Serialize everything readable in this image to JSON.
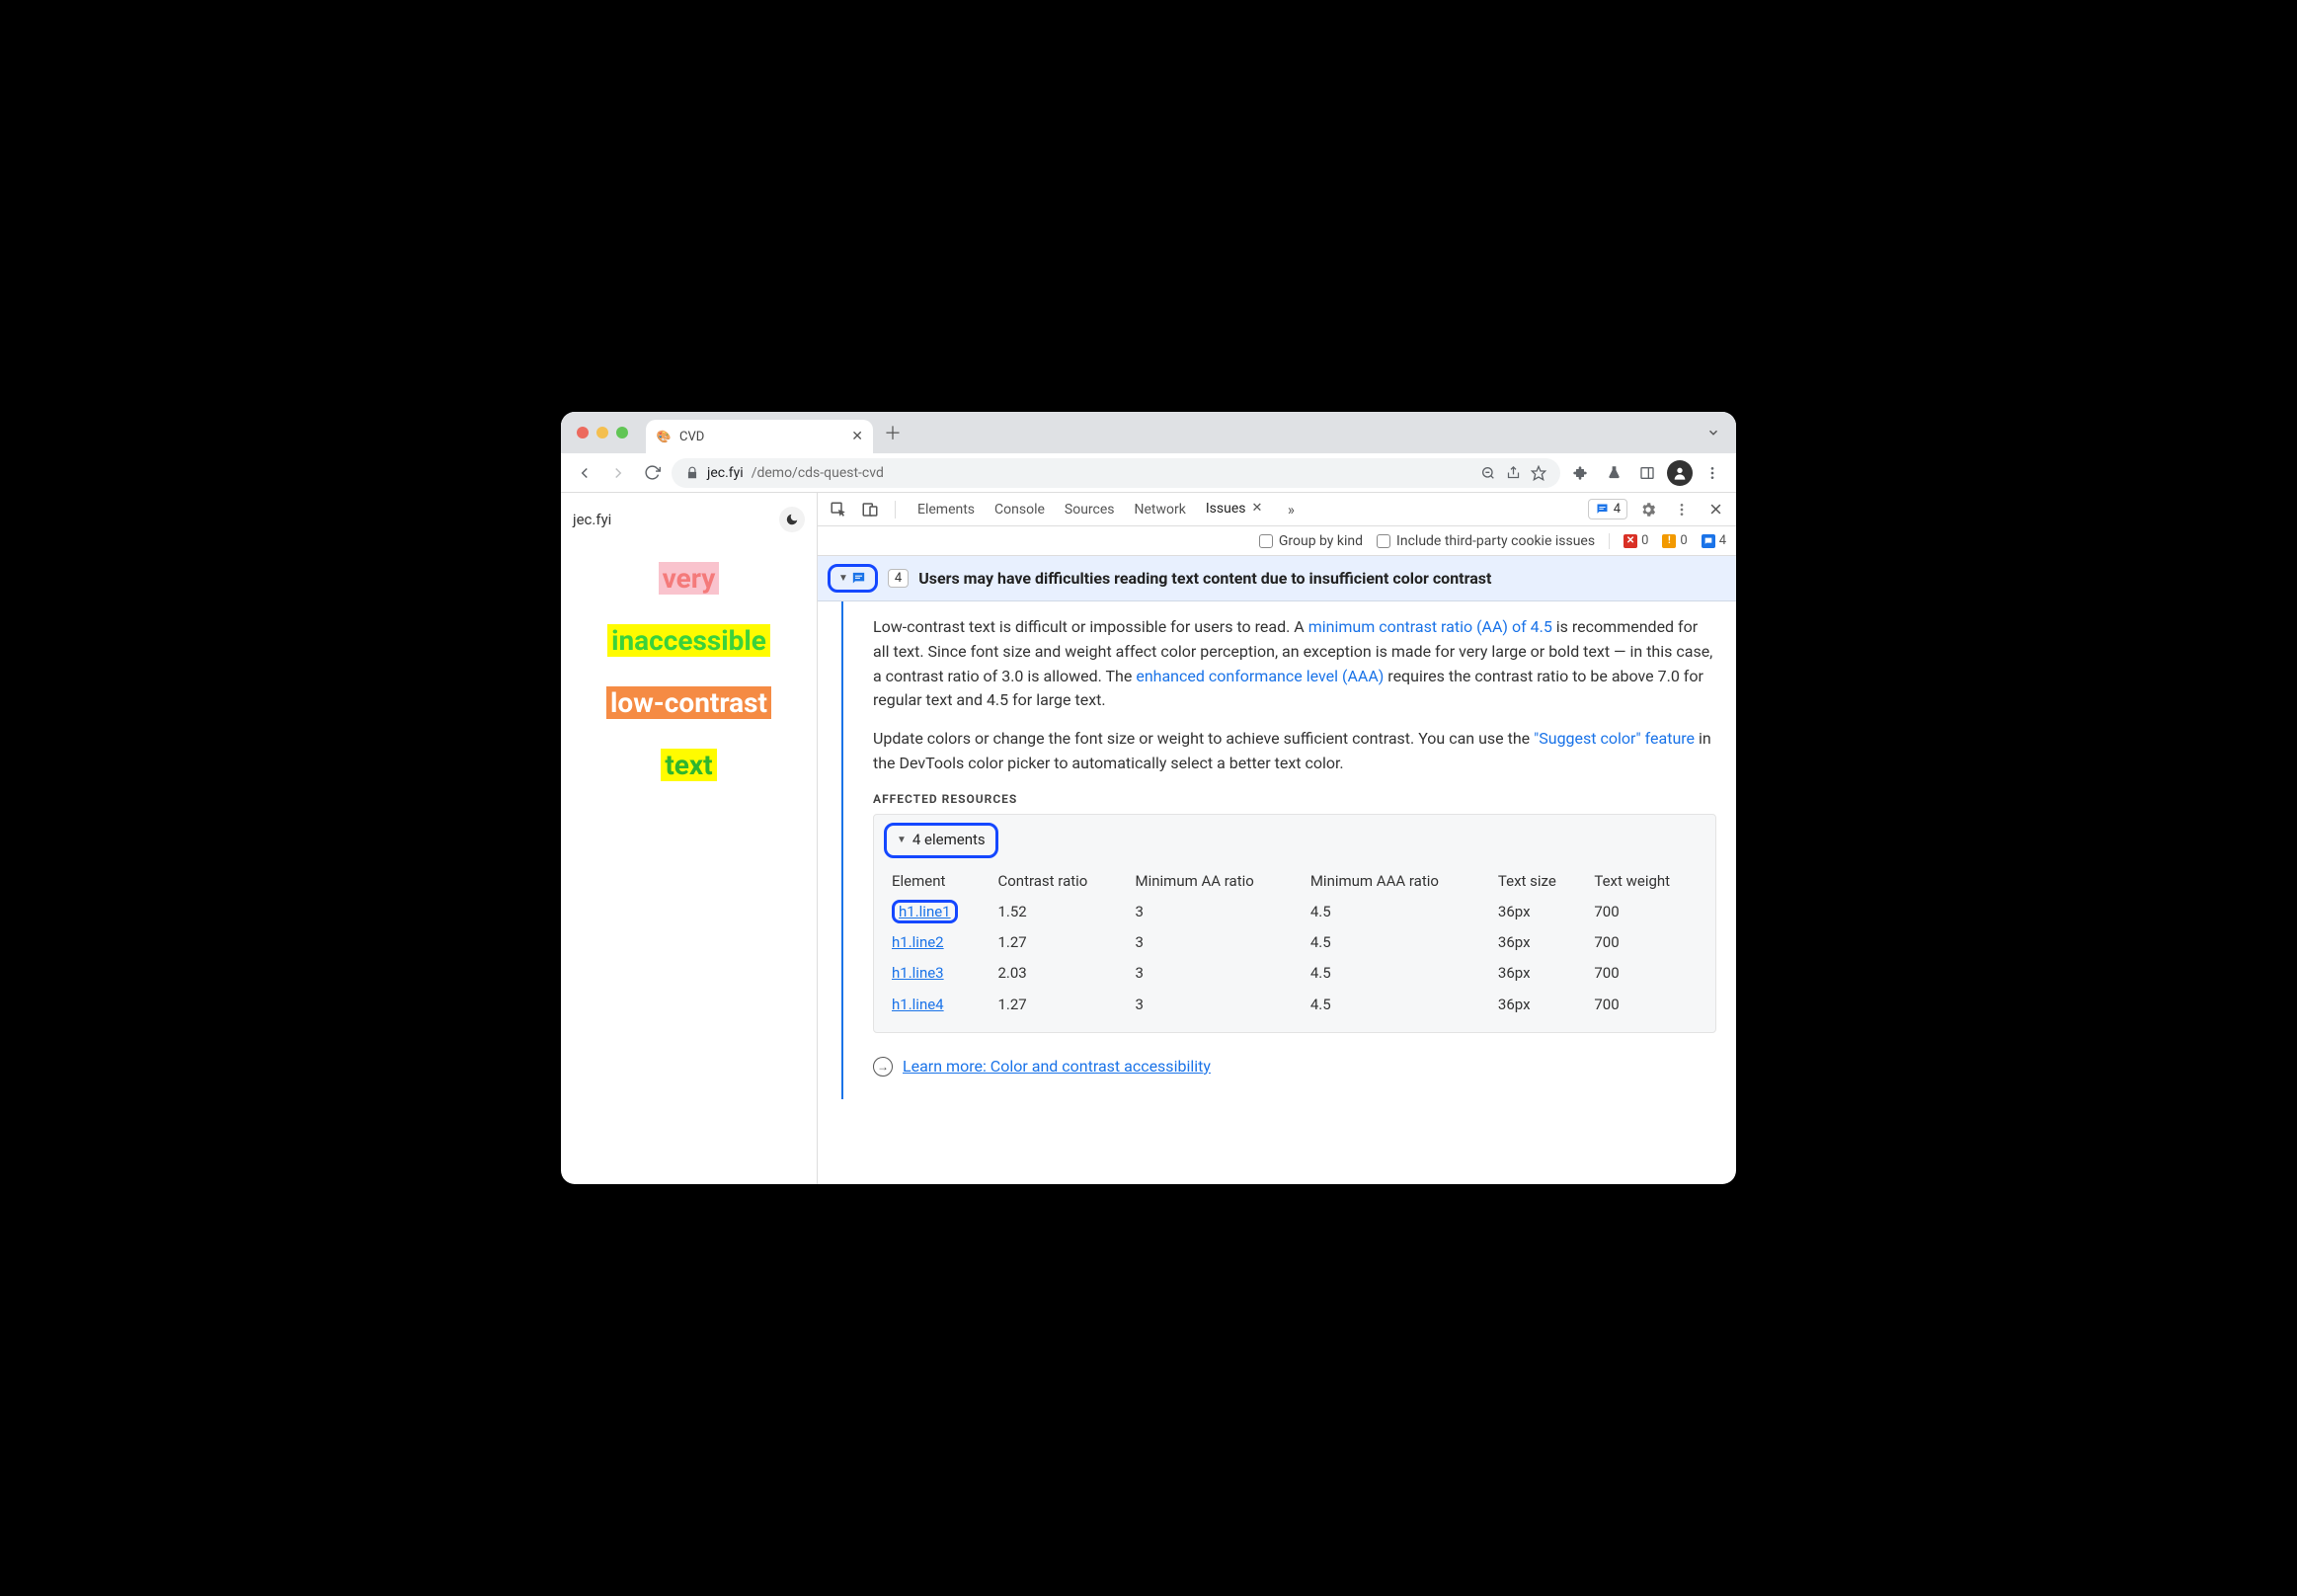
{
  "browser": {
    "tab_title": "CVD",
    "url_domain": "jec.fyi",
    "url_path": "/demo/cds-quest-cvd"
  },
  "page": {
    "site_title": "jec.fyi",
    "words": [
      {
        "text": "very",
        "fg": "#f47a7a",
        "bg": "#f9c3cd"
      },
      {
        "text": "inaccessible",
        "fg": "#3bd23b",
        "bg": "#fffb00"
      },
      {
        "text": "low-contrast",
        "fg": "#ffffff",
        "bg": "#f58b44"
      },
      {
        "text": "text",
        "fg": "#2fb62f",
        "bg": "#fffb00"
      }
    ]
  },
  "devtools": {
    "tabs": [
      "Elements",
      "Console",
      "Sources",
      "Network",
      "Issues"
    ],
    "active_tab": "Issues",
    "badge_count": "4",
    "counters": {
      "errors": "0",
      "warnings": "0",
      "info": "4"
    },
    "filters": {
      "group": "Group by kind",
      "third": "Include third-party cookie issues"
    }
  },
  "issue": {
    "count": "4",
    "title": "Users may have difficulties reading text content due to insufficient color contrast",
    "desc_pre": "Low-contrast text is difficult or impossible for users to read. A ",
    "link1": "minimum contrast ratio (AA) of 4.5",
    "desc_mid": " is recommended for all text. Since font size and weight affect color perception, an exception is made for very large or bold text — in this case, a contrast ratio of 3.0 is allowed. The ",
    "link2": "enhanced conformance level (AAA)",
    "desc_post": " requires the contrast ratio to be above 7.0 for regular text and 4.5 for large text.",
    "p2_pre": "Update colors or change the font size or weight to achieve sufficient contrast. You can use the ",
    "link3": "\"Suggest color\" feature",
    "p2_post": " in the DevTools color picker to automatically select a better text color.",
    "resources_label": "AFFECTED RESOURCES",
    "resources_toggle": "4 elements",
    "headers": [
      "Element",
      "Contrast ratio",
      "Minimum AA ratio",
      "Minimum AAA ratio",
      "Text size",
      "Text weight"
    ],
    "rows": [
      {
        "el": "h1.line1",
        "cr": "1.52",
        "aa": "3",
        "aaa": "4.5",
        "size": "36px",
        "weight": "700"
      },
      {
        "el": "h1.line2",
        "cr": "1.27",
        "aa": "3",
        "aaa": "4.5",
        "size": "36px",
        "weight": "700"
      },
      {
        "el": "h1.line3",
        "cr": "2.03",
        "aa": "3",
        "aaa": "4.5",
        "size": "36px",
        "weight": "700"
      },
      {
        "el": "h1.line4",
        "cr": "1.27",
        "aa": "3",
        "aaa": "4.5",
        "size": "36px",
        "weight": "700"
      }
    ],
    "learn_more": "Learn more: Color and contrast accessibility"
  }
}
